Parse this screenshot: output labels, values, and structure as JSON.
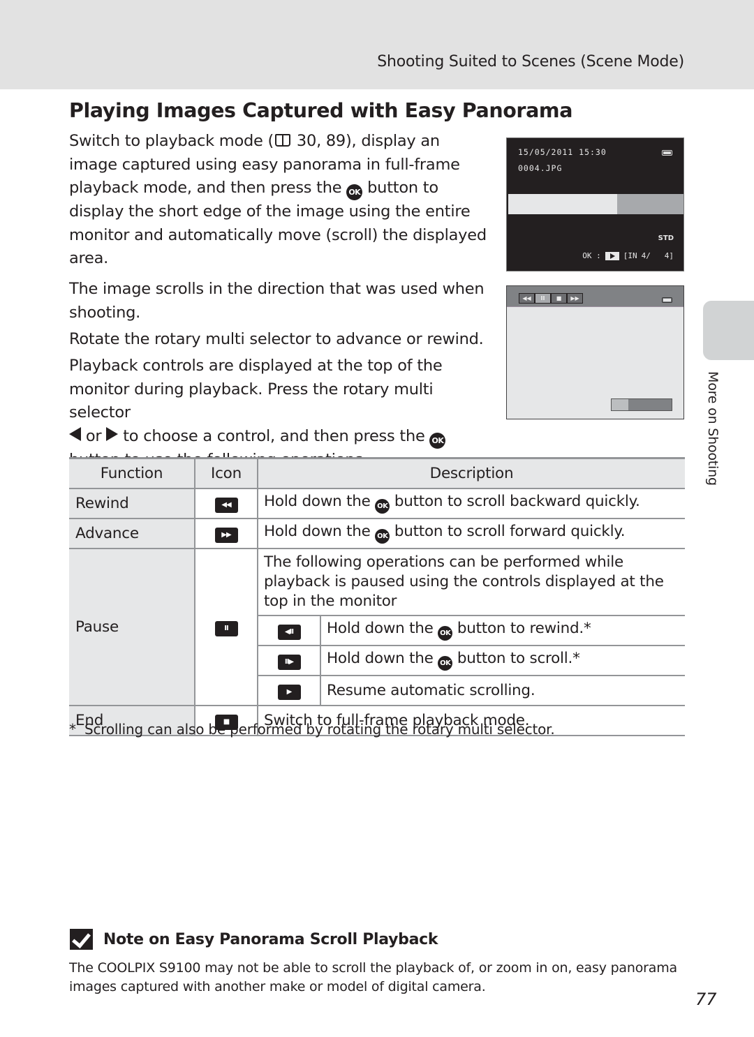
{
  "header": {
    "section_title": "Shooting Suited to Scenes (Scene Mode)"
  },
  "page_title": "Playing Images Captured with Easy Panorama",
  "intro": {
    "part1": "Switch to playback mode (",
    "ref_icon": "book-reference-icon",
    "part2": " 30, 89), display an image captured using easy panorama in full-frame playback mode, and then press the ",
    "ok_label": "OK",
    "part3": " button to display the short edge of the image using the entire monitor and automatically move (scroll) the displayed area."
  },
  "para2": "The image scrolls in the direction that was used when shooting.",
  "para3": "Rotate the rotary multi selector to advance or rewind.",
  "para4": {
    "part1": "Playback controls are displayed at the top of the monitor during playback. Press the rotary multi selector ",
    "or": " or ",
    "part2": " to choose a control, and then press the ",
    "ok_label": "OK",
    "part3": " button to use the following operations."
  },
  "screen1": {
    "datetime": "15/05/2011 15:30",
    "filename": "0004.JPG",
    "std_label": "STD",
    "ok_label": "OK :",
    "memory_label": "[IN",
    "counter": "4/   4]",
    "visible_portion": 0.62
  },
  "screen2": {
    "controls": [
      "◀◀",
      "II",
      "■",
      "▶▶"
    ],
    "selected_control": 1,
    "scroll_position": 0.28
  },
  "side_tab": {
    "label": "More on Shooting"
  },
  "table": {
    "headers": [
      "Function",
      "Icon",
      "Description"
    ],
    "rows": [
      {
        "function": "Rewind",
        "icon": "◀◀",
        "desc_a": "Hold down the ",
        "ok": "OK",
        "desc_b": " button to scroll backward quickly."
      },
      {
        "function": "Advance",
        "icon": "▶▶",
        "desc_a": "Hold down the ",
        "ok": "OK",
        "desc_b": " button to scroll forward quickly."
      },
      {
        "function": "Pause",
        "icon": "II",
        "note": "The following operations can be performed while playback is paused using the controls displayed at the top in the monitor",
        "sub": [
          {
            "icon": "◀II",
            "desc_a": "Hold down the ",
            "ok": "OK",
            "desc_b": " button to rewind.*"
          },
          {
            "icon": "II▶",
            "desc_a": "Hold down the ",
            "ok": "OK",
            "desc_b": " button to scroll.*"
          },
          {
            "icon": "▶",
            "desc": "Resume automatic scrolling."
          }
        ]
      },
      {
        "function": "End",
        "icon": "■",
        "desc": "Switch to full-frame playback mode."
      }
    ]
  },
  "footnote": {
    "mark": "*",
    "text": "Scrolling can also be performed by rotating the rotary multi selector."
  },
  "note": {
    "title": "Note on Easy Panorama Scroll Playback",
    "text": "The COOLPIX S9100 may not be able to scroll the playback of, or zoom in on, easy panorama images captured with another make or model of digital camera."
  },
  "page_number": "77"
}
